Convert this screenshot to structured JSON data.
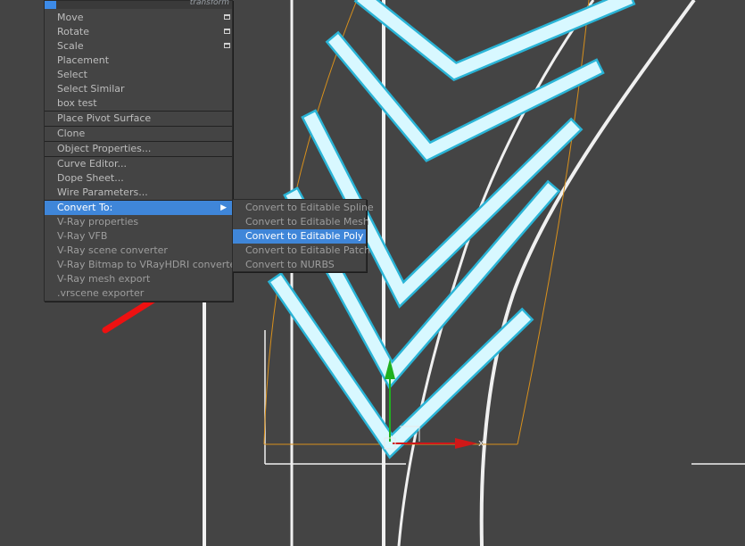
{
  "viewport": {
    "axis_label": "x",
    "colors": {
      "background": "#444444",
      "shape_fill": "#d8f8ff",
      "shape_outline": "#2ab4d6",
      "guide_line": "#f0f0f0",
      "bounding": "#d8901c",
      "gizmo_x": "#d01818",
      "gizmo_y": "#1fb01f"
    }
  },
  "quad_menu": {
    "header": "transform",
    "items": [
      {
        "label": "Move",
        "options": true
      },
      {
        "label": "Rotate",
        "options": true
      },
      {
        "label": "Scale",
        "options": true
      },
      {
        "label": "Placement"
      },
      {
        "label": "Select"
      },
      {
        "label": "Select Similar"
      },
      {
        "label": "box test"
      },
      {
        "label": "Place Pivot Surface"
      },
      {
        "label": "Clone"
      },
      {
        "label": "Object Properties..."
      },
      {
        "label": "Curve Editor..."
      },
      {
        "label": "Dope Sheet..."
      },
      {
        "label": "Wire Parameters..."
      },
      {
        "label": "Convert To:",
        "highlighted": true,
        "submenu": true
      },
      {
        "label": "V-Ray properties"
      },
      {
        "label": "V-Ray VFB"
      },
      {
        "label": "V-Ray scene converter"
      },
      {
        "label": "V-Ray Bitmap to VRayHDRI converter"
      },
      {
        "label": "V-Ray mesh export"
      },
      {
        "label": ".vrscene exporter"
      }
    ]
  },
  "submenu": {
    "items": [
      {
        "label": "Convert to Editable Spline"
      },
      {
        "label": "Convert to Editable Mesh"
      },
      {
        "label": "Convert to Editable Poly",
        "highlighted": true
      },
      {
        "label": "Convert to Editable Patch"
      },
      {
        "label": "Convert to NURBS"
      }
    ]
  },
  "annotation": {
    "arrow_color": "#ee1111"
  }
}
